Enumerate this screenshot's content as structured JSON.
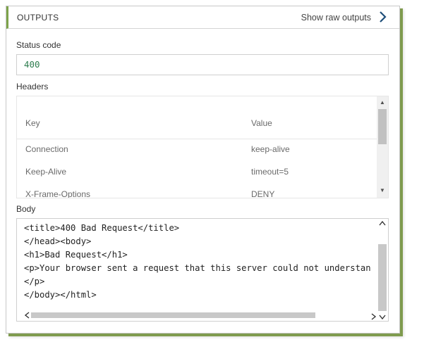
{
  "outputs": {
    "title": "OUTPUTS",
    "show_raw_label": "Show raw outputs"
  },
  "status": {
    "label": "Status code",
    "value": "400"
  },
  "headers": {
    "label": "Headers",
    "col_key": "Key",
    "col_value": "Value",
    "rows": [
      {
        "key": "Connection",
        "value": "keep-alive"
      },
      {
        "key": "Keep-Alive",
        "value": "timeout=5"
      },
      {
        "key": "X-Frame-Options",
        "value": "DENY"
      }
    ]
  },
  "body": {
    "label": "Body",
    "lines": [
      "<title>400 Bad Request</title>",
      "</head><body>",
      "<h1>Bad Request</h1>",
      "<p>Your browser sent a request that this server could not understan",
      "</p>",
      "</body></html>"
    ]
  },
  "colors": {
    "accent": "#7da34a",
    "status_code_color": "#2e7d4f",
    "chevron_color": "#1f4e79"
  }
}
